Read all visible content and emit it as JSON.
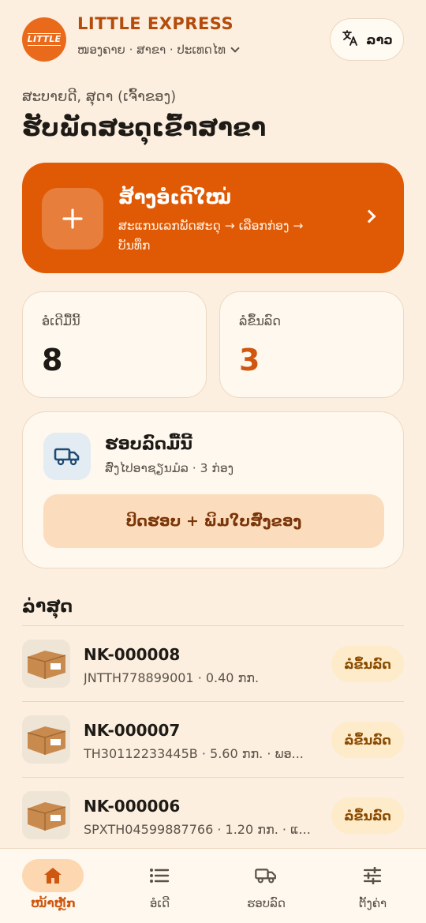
{
  "app": {
    "logo_text": "LITTLE",
    "name": "LITTLE EXPRESS",
    "location": "ໜອງຄາຍ · ສາຂາ · ປະເທດໄທ",
    "language_label": "ລາວ"
  },
  "greeting": "ສະບາຍດີ, ສຸດາ (ເຈົ້າຂອງ)",
  "page_title": "ຮັບພັດສະດຸເຂົ້າສາຂາ",
  "new_order": {
    "title": "ສ້າງອໍເດີໃໝ່",
    "subtitle": "ສະແກນເລກພັດສະດຸ → ເລືອກກ່ອງ → ບັນທຶກ"
  },
  "stats": {
    "orders_today_label": "ອໍເດີມື້ນີ້",
    "orders_today_value": "8",
    "awaiting_label": "ລໍຂຶ້ນລົດ",
    "awaiting_value": "3"
  },
  "batch": {
    "title": "ຮອບລົດມື້ນີ້",
    "subtitle": "ສົ່ງໄປອາຊຽນມໍລ · 3 ກ່ອງ",
    "button_label": "ປິດຮອບ + ພິມໃບສົ່ງຂອງ"
  },
  "recent": {
    "title": "ລ່າສຸດ",
    "items": [
      {
        "id": "NK-000008",
        "detail": "JNTTH778899001 · 0.40 ກກ.",
        "status": "ລໍຂຶ້ນລົດ"
      },
      {
        "id": "NK-000007",
        "detail": "TH30112233445B · 5.60 ກກ. · ພອ...",
        "status": "ລໍຂຶ້ນລົດ"
      },
      {
        "id": "NK-000006",
        "detail": "SPXTH04599887766 · 1.20 ກກ. · ແ...",
        "status": "ລໍຂຶ້ນລົດ"
      }
    ]
  },
  "nav": {
    "items": [
      {
        "label": "ໜ້າຫຼັກ",
        "icon": "home-icon",
        "active": true
      },
      {
        "label": "ອໍເດີ",
        "icon": "list-icon",
        "active": false
      },
      {
        "label": "ຮອບລົດ",
        "icon": "truck-icon",
        "active": false
      },
      {
        "label": "ຕັ້ງຄ່າ",
        "icon": "sliders-icon",
        "active": false
      }
    ]
  },
  "colors": {
    "background": "#fcefdf",
    "accent": "#e05a05",
    "brand_text": "#b54c0c",
    "badge_bg": "#fdebc9"
  }
}
